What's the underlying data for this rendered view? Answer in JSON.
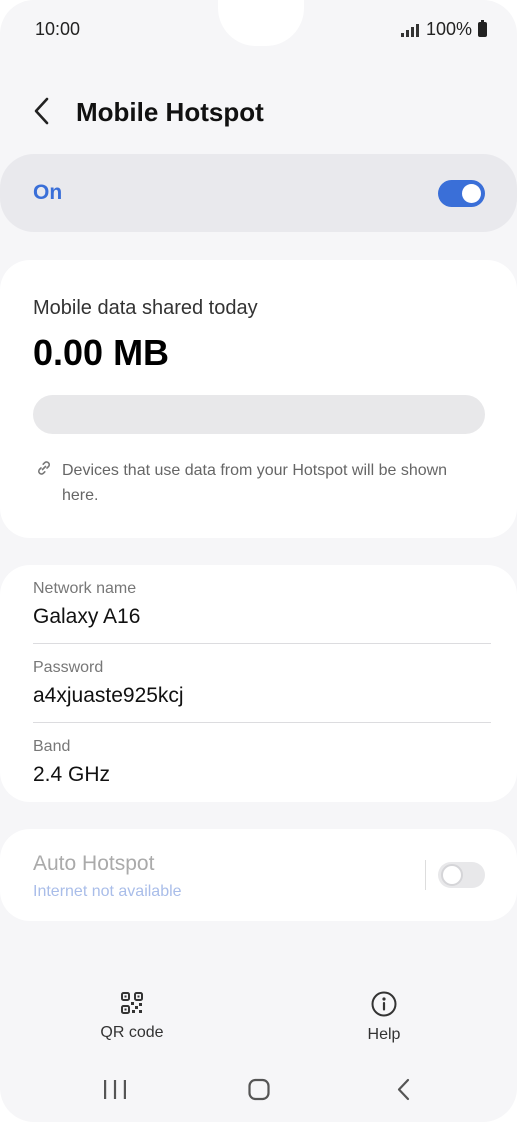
{
  "status_bar": {
    "time": "10:00",
    "battery": "100%",
    "icons": [
      "signal-icon",
      "battery-icon"
    ]
  },
  "header": {
    "title": "Mobile Hotspot",
    "back_icon": "back-arrow-icon"
  },
  "hotspot_toggle": {
    "label": "On",
    "state": true,
    "accent_color": "#3a6fd8"
  },
  "data_usage": {
    "label": "Mobile data shared today",
    "value": "0.00 MB",
    "fill_fraction": 0,
    "devices_note": "Devices that use data from your Hotspot will be shown here.",
    "note_icon": "link-icon"
  },
  "network": {
    "name_label": "Network name",
    "name_value": "Galaxy A16",
    "password_label": "Password",
    "password_value": "a4xjuaste925kcj",
    "band_label": "Band",
    "band_value": "2.4 GHz"
  },
  "auto_hotspot": {
    "title": "Auto Hotspot",
    "subtitle": "Internet not available",
    "state": false
  },
  "bottom_actions": {
    "qr_label": "QR code",
    "qr_icon": "qr-code-icon",
    "help_label": "Help",
    "help_icon": "info-circle-icon"
  },
  "nav_bar": {
    "icons": [
      "recent-apps-icon",
      "home-icon",
      "back-icon"
    ]
  }
}
